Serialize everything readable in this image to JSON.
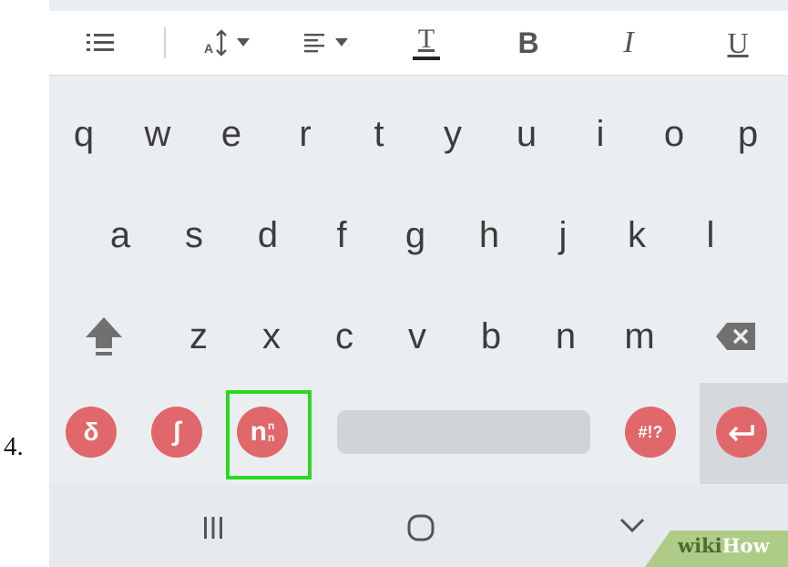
{
  "step_number": "4.",
  "toolbar": {
    "icons": [
      "list-icon",
      "font-size-icon",
      "align-icon",
      "text-color-icon",
      "bold-icon",
      "italic-icon",
      "underline-icon"
    ],
    "bold_label": "B",
    "italic_label": "I",
    "underline_label": "U",
    "text_color_label": "T"
  },
  "keyboard": {
    "row1": [
      "q",
      "w",
      "e",
      "r",
      "t",
      "y",
      "u",
      "i",
      "o",
      "p"
    ],
    "row2": [
      "a",
      "s",
      "d",
      "f",
      "g",
      "h",
      "j",
      "k",
      "l"
    ],
    "row3": [
      "z",
      "x",
      "c",
      "v",
      "b",
      "n",
      "m"
    ],
    "bottom": {
      "delta_label": "δ",
      "integral_label": "ʃ",
      "exponent_label": "n",
      "exponent_sup": "n",
      "exponent_sub": "n",
      "symbols_label": "#!?"
    }
  },
  "watermark": {
    "wiki": "wiki",
    "how": "How"
  },
  "colors": {
    "keyboard_bg": "#ebeef1",
    "function_key": "#e0676a",
    "highlight": "#2ad91f",
    "watermark_green": "#aecb87"
  }
}
